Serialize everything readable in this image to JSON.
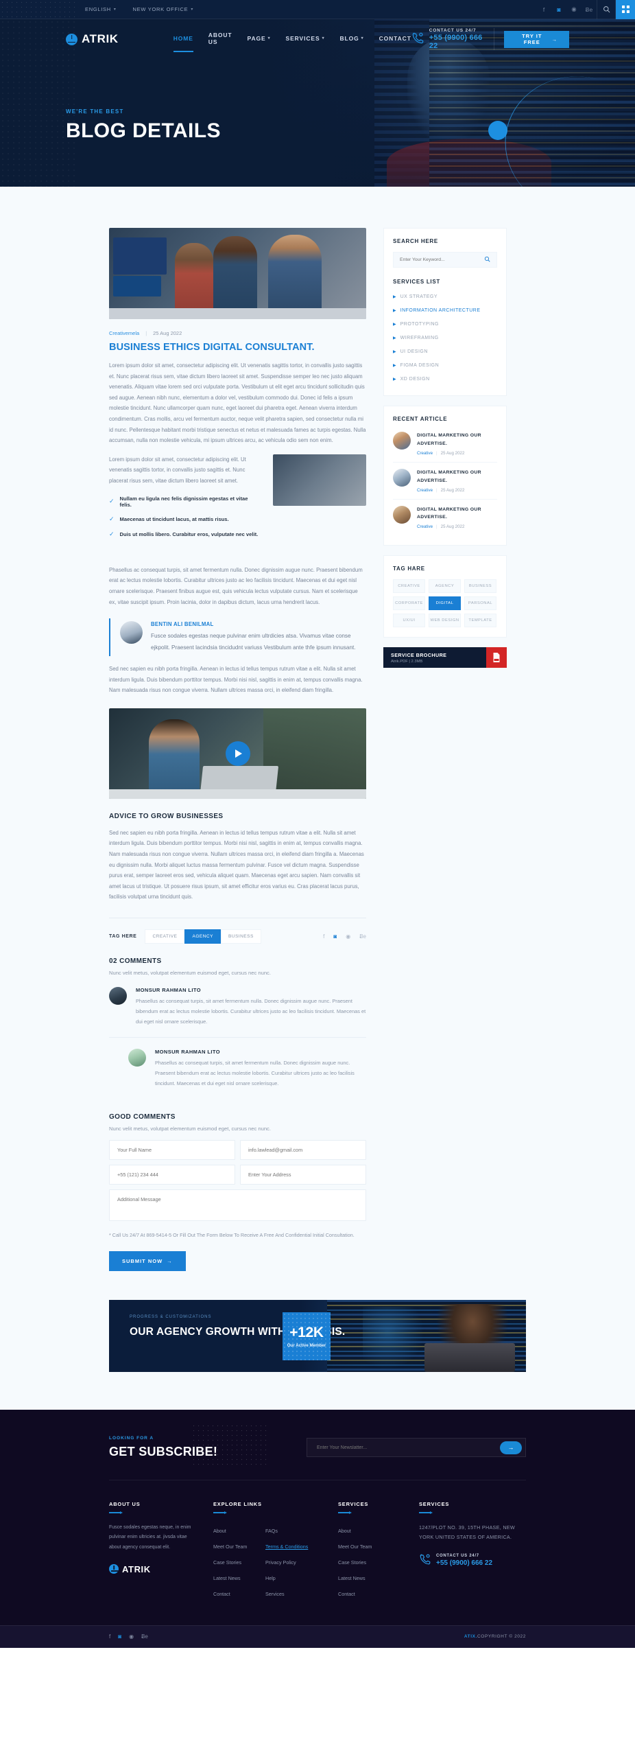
{
  "topbar": {
    "language": "ENGLISH",
    "office": "NEW YORK OFFICE",
    "socials": [
      "facebook-icon",
      "instagram-icon",
      "dribbble-icon",
      "behance-icon"
    ],
    "search_icon": "search-icon",
    "grid_icon": "grid-icon"
  },
  "brand": {
    "name": "ATRIK"
  },
  "nav": {
    "items": [
      {
        "label": "HOME",
        "active": true,
        "caret": false
      },
      {
        "label": "ABOUT US",
        "active": false,
        "caret": false
      },
      {
        "label": "PAGE",
        "active": false,
        "caret": true
      },
      {
        "label": "SERVICES",
        "active": false,
        "caret": true
      },
      {
        "label": "BLOG",
        "active": false,
        "caret": true
      },
      {
        "label": "CONTACT",
        "active": false,
        "caret": false
      }
    ],
    "contact_label": "CONTACT US 24/7",
    "contact_number": "+55 (9900) 666 22",
    "cta_label": "TRY IT FREE"
  },
  "hero": {
    "eyebrow": "WE'RE THE BEST",
    "title": "BLOG DETAILS"
  },
  "post": {
    "category": "Creativemela",
    "date": "25 Aug 2022",
    "title": "BUSINESS ETHICS DIGITAL CONSULTANT.",
    "paragraph1": "Lorem ipsum dolor sit amet, consectetur adipiscing elit. Ut venenatis sagittis tortor, in convallis justo sagittis et. Nunc placerat risus sem, vitae dictum libero laoreet sit amet. Suspendisse semper leo nec justo aliquam venenatis. Aliquam vitae lorem sed orci vulputate porta. Vestibulum ut elit eget arcu tincidunt sollicitudin quis sed augue. Aenean nibh nunc, elementum a dolor vel, vestibulum commodo dui. Donec id felis a ipsum molestie tincidunt. Nunc ullamcorper quam nunc, eget laoreet dui pharetra eget. Aenean viverra interdum condimentum. Cras mollis, arcu vel fermentum auctor, neque velit pharetra sapien, sed consectetur nulla mi id nunc. Pellentesque habitant morbi tristique senectus et netus et malesuada fames ac turpis egestas. Nulla accumsan, nulla non molestie vehicula, mi ipsum ultrices arcu, ac vehicula odio sem non enim.",
    "paragraph2": "Lorem ipsum dolor sit amet, consectetur adipiscing elit. Ut venenatis sagittis tortor, in convallis justo sagittis et. Nunc placerat risus sem, vitae dictum libero laoreet sit amet.",
    "checklist": [
      "Nullam eu ligula nec felis dignissim egestas et vitae felis.",
      "Maecenas ut tincidunt lacus, at mattis risus.",
      "Duis ut mollis libero. Curabitur eros, vulputate nec velit."
    ],
    "paragraph3": "Phasellus ac consequat turpis, sit amet fermentum nulla. Donec dignissim augue nunc. Praesent bibendum erat ac lectus molestie lobortis. Curabitur ultrices justo ac leo facilisis tincidunt. Maecenas et dui eget nisl ornare scelerisque. Praesent finibus augue est, quis vehicula lectus vulputate cursus. Nam et scelerisque ex, vitae suscipit ipsum. Proin lacinia, dolor in dapibus dictum, lacus urna hendrerit lacus.",
    "quote": {
      "author": "BENTIN ALI BENILMAL",
      "text": "Fusce sodales egestas neque pulvinar enim ultrdicies atsa. Vivamus vitae conse ejkpolit. Praesent lacindsia tincidudnt variuss Vestibulum ante thfe ipsum innusant."
    },
    "paragraph4": "Sed nec sapien eu nibh porta fringilla. Aenean in lectus id tellus tempus rutrum vitae a elit. Nulla sit amet interdum ligula. Duis bibendum porttitor tempus. Morbi nisi nisl, sagittis in enim at, tempus convallis magna. Nam malesuada risus non congue viverra. Nullam ultrices massa orci, in eleifend diam fringilla.",
    "video_play_icon": "play-icon",
    "section2_title": "ADVICE TO GROW BUSINESSES",
    "paragraph5": "Sed nec sapien eu nibh porta fringilla. Aenean in lectus id tellus tempus rutrum vitae a elit. Nulla sit amet interdum ligula. Duis bibendum porttitor tempus. Morbi nisi nisl, sagittis in enim at, tempus convallis magna. Nam malesuada risus non congue viverra. Nullam ultrices massa orci, in eleifend diam fringilla a. Maecenas eu dignissim nulla. Morbi aliquet luctus massa fermentum pulvinar. Fusce vel dictum magna. Suspendisse purus erat, semper laoreet eros sed, vehicula aliquet quam. Maecenas eget arcu sapien. Nam convallis sit amet lacus ut tristique. Ut posuere risus ipsum, sit amet efficitur eros varius eu. Cras placerat lacus purus, facilisis volutpat urna tincidunt quis."
  },
  "tagrow": {
    "label": "TAG HERE",
    "tags": [
      {
        "label": "CREATIVE",
        "active": false
      },
      {
        "label": "AGENCY",
        "active": true
      },
      {
        "label": "BUSINESS",
        "active": false
      }
    ],
    "share_icons": [
      "facebook-icon",
      "instagram-icon",
      "dribbble-icon",
      "behance-icon"
    ]
  },
  "comments": {
    "title": "02 COMMENTS",
    "subtitle": "Nunc velit metus, volutpat elementum euismod eget, cursus nec nunc.",
    "items": [
      {
        "name": "MONSUR RAHMAN LITO",
        "text": "Phasellus ac consequat turpis, sit amet fermentum nulla. Donec dignissim augue nunc. Praesent bibendum erat ac lectus molestie lobortis. Curabitur ultrices justo ac leo facilisis tincidunt. Maecenas et dui eget nisl ornare scelerisque."
      },
      {
        "name": "MONSUR RAHMAN LITO",
        "text": "Phasellus ac consequat turpis, sit amet fermentum nulla. Donec dignissim augue nunc. Praesent bibendum erat ac lectus molestie lobortis. Curabitur ultrices justo ac leo facilisis tincidunt. Maecenas et dui eget nisl ornare scelerisque."
      }
    ]
  },
  "form": {
    "title": "GOOD COMMENTS",
    "subtitle": "Nunc velit metus, volutpat elementum euismod eget, cursus nec nunc.",
    "name_placeholder": "Your Full Name",
    "email_placeholder": "info.lawlead@gmail.com",
    "phone_placeholder": "+55 (121) 234 444",
    "address_placeholder": "Enter Your Address",
    "message_placeholder": "Additional Message",
    "note": "* Call Us 24/7 At 869-5414-5 Or Fill Out The Form Below To Receive A Free And Confidential Initial Consultation.",
    "submit_label": "SUBMIT NOW"
  },
  "sidebar": {
    "search": {
      "title": "SEARCH HERE",
      "placeholder": "Enter Your Keyword...",
      "icon": "search-icon"
    },
    "services": {
      "title": "SERVICES LIST",
      "items": [
        {
          "label": "UX STRATEGY",
          "active": false
        },
        {
          "label": "INFORMATION ARCHITECTURE",
          "active": true
        },
        {
          "label": "PROTOTYPING",
          "active": false
        },
        {
          "label": "WIREFRAMING",
          "active": false
        },
        {
          "label": "UI DESIGN",
          "active": false
        },
        {
          "label": "FIGMA DESIGN",
          "active": false
        },
        {
          "label": "XD DESIGN",
          "active": false
        }
      ]
    },
    "recent": {
      "title": "RECENT ARTICLE",
      "items": [
        {
          "title": "DIGITAL MARKETING OUR ADVERTISE.",
          "category": "Creative",
          "date": "25 Aug 2022"
        },
        {
          "title": "DIGITAL MARKETING OUR ADVERTISE.",
          "category": "Creative",
          "date": "25 Aug 2022"
        },
        {
          "title": "DIGITAL MARKETING OUR ADVERTISE.",
          "category": "Creative",
          "date": "25 Aug 2022"
        }
      ]
    },
    "tagbox": {
      "title": "TAG HARE",
      "tags": [
        {
          "label": "CREATIVE",
          "active": false
        },
        {
          "label": "AGENCY",
          "active": false
        },
        {
          "label": "BUSINESS",
          "active": false
        },
        {
          "label": "CORPORATE",
          "active": false
        },
        {
          "label": "DIGITAL",
          "active": true
        },
        {
          "label": "PARSONAL",
          "active": false
        },
        {
          "label": "UX/UI",
          "active": false
        },
        {
          "label": "WEB DESIGN",
          "active": false
        },
        {
          "label": "TEMPLATE",
          "active": false
        }
      ]
    },
    "brochure": {
      "title": "SERVICE BROCHURE",
      "meta": "Atrik.PDF  |  2.3MB",
      "icon": "pdf-file-icon"
    }
  },
  "cta": {
    "eyebrow": "PROGRESS & CUSTOMIZATIONS",
    "title": "OUR AGENCY GROWTH WITH ANALYSIS.",
    "badge_number": "+12K",
    "badge_label": "Our Active Member"
  },
  "subscribe": {
    "eyebrow": "LOOKING FOR A",
    "title": "GET SUBSCRIBE!",
    "placeholder": "Enter Your Newslatter...",
    "button_icon": "arrow-right-icon"
  },
  "footer": {
    "about": {
      "title": "ABOUT US",
      "text": "Fusce sodales egestas neque, in enim pulvinar enim ultricies at. jivsda vitae about agency  consequat elit.",
      "logo": "ATRIK"
    },
    "explore": {
      "title": "EXPLORE LINKS",
      "col1": [
        "About",
        "Meet Our Team",
        "Case Stories",
        "Latest News",
        "Contact"
      ],
      "col2": [
        "FAQs",
        "Terms & Conditions",
        "Privacy Policy",
        "Help",
        "Services"
      ],
      "highlight": "Terms & Conditions"
    },
    "services": {
      "title": "SERVICES",
      "links": [
        "About",
        "Meet Our Team",
        "Case Stories",
        "Latest News",
        "Contact"
      ]
    },
    "contact": {
      "title": "SERVICES",
      "address": "1247/PLOT NO. 39, 15TH PHASE, NEW YORK UNITED STATES OF AMERICA.",
      "call_label": "CONTACT US 24/7",
      "call_number": "+55 (9900) 666 22"
    },
    "bottom": {
      "socials": [
        "facebook-icon",
        "instagram-icon",
        "dribbble-icon",
        "behance-icon"
      ],
      "copyright_brand": "ATIX.",
      "copyright_rest": "COPYRIGHT © 2022"
    }
  }
}
